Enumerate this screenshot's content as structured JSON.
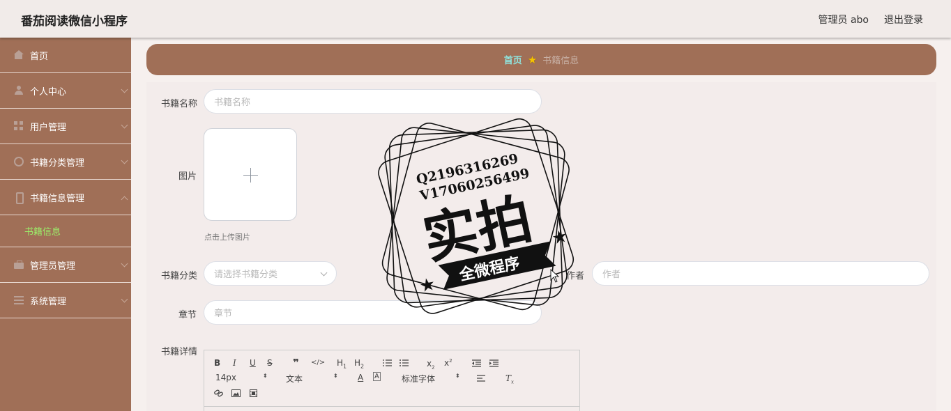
{
  "header": {
    "app_title": "番茄阅读微信小程序",
    "user_label": "管理员 abo",
    "logout_label": "退出登录"
  },
  "sidebar": {
    "items": [
      {
        "label": "首页",
        "icon": "home-icon"
      },
      {
        "label": "个人中心",
        "icon": "user-icon"
      },
      {
        "label": "用户管理",
        "icon": "grid-icon"
      },
      {
        "label": "书籍分类管理",
        "icon": "globe-icon"
      },
      {
        "label": "书籍信息管理",
        "icon": "phone-icon",
        "expanded": true,
        "children": [
          {
            "label": "书籍信息"
          }
        ]
      },
      {
        "label": "管理员管理",
        "icon": "briefcase-icon"
      },
      {
        "label": "系统管理",
        "icon": "list-icon"
      }
    ]
  },
  "breadcrumb": {
    "home": "首页",
    "current": "书籍信息"
  },
  "form": {
    "book_name": {
      "label": "书籍名称",
      "placeholder": "书籍名称"
    },
    "image": {
      "label": "图片",
      "tip": "点击上传图片"
    },
    "category": {
      "label": "书籍分类",
      "placeholder": "请选择书籍分类"
    },
    "author": {
      "label": "作者",
      "placeholder": "作者"
    },
    "chapter": {
      "label": "章节",
      "placeholder": "章节"
    },
    "details": {
      "label": "书籍详情"
    }
  },
  "editor_toolbar": {
    "font_size": "14px",
    "paragraph": "文本",
    "font_family": "标准字体",
    "buttons_row1": [
      "B",
      "I",
      "U",
      "S",
      "❞",
      "</>",
      "H1",
      "H2",
      "ol",
      "ul",
      "x2-sub",
      "x2-sup",
      "outdent",
      "indent"
    ],
    "buttons_row3": [
      "link",
      "image",
      "video"
    ]
  },
  "stamp": {
    "line1": "Q2196316269",
    "line2": "V17060256499",
    "big_text": "实拍",
    "ribbon_text": "全微程序"
  },
  "colors": {
    "sidebar_bg": "#a06f57",
    "breadcrumb_bg": "#a06f57",
    "active_submenu": "#9bef6a",
    "crumb_home": "#8fe6e0",
    "page_bg": "#f6f0ee"
  }
}
